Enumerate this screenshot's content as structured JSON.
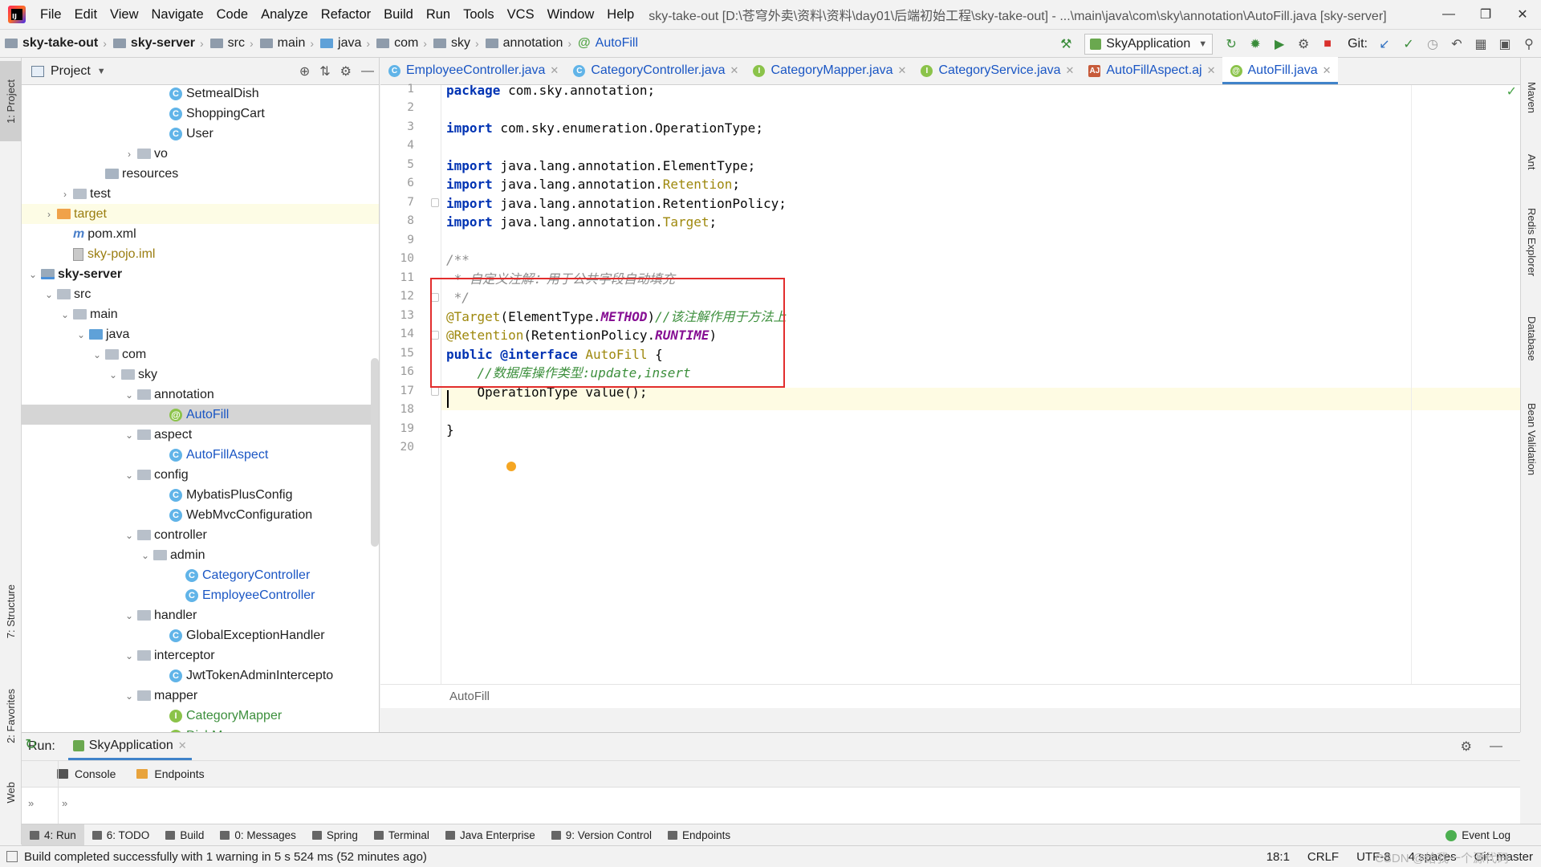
{
  "menu": {
    "items": [
      "File",
      "Edit",
      "View",
      "Navigate",
      "Code",
      "Analyze",
      "Refactor",
      "Build",
      "Run",
      "Tools",
      "VCS",
      "Window",
      "Help"
    ],
    "title": "sky-take-out [D:\\苍穹外卖\\资料\\资料\\day01\\后端初始工程\\sky-take-out] - ...\\main\\java\\com\\sky\\annotation\\AutoFill.java [sky-server]"
  },
  "breadcrumbs": [
    "sky-take-out",
    "sky-server",
    "src",
    "main",
    "java",
    "com",
    "sky",
    "annotation",
    "AutoFill"
  ],
  "toolbar": {
    "run_config": "SkyApplication",
    "git_label": "Git:"
  },
  "project": {
    "title": "Project",
    "tree": [
      {
        "label": "SetmealDish",
        "type": "class",
        "indent": 9
      },
      {
        "label": "ShoppingCart",
        "type": "class",
        "indent": 9
      },
      {
        "label": "User",
        "type": "class",
        "indent": 9
      },
      {
        "label": "vo",
        "type": "pkg",
        "indent": 7,
        "arrow": "›"
      },
      {
        "label": "resources",
        "type": "res",
        "indent": 5
      },
      {
        "label": "test",
        "type": "pkg",
        "indent": 3,
        "arrow": "›"
      },
      {
        "label": "target",
        "type": "orange",
        "indent": 2,
        "arrow": "›"
      },
      {
        "label": "pom.xml",
        "type": "maven",
        "indent": 3
      },
      {
        "label": "sky-pojo.iml",
        "type": "file",
        "indent": 3
      },
      {
        "label": "sky-server",
        "type": "mod",
        "indent": 1,
        "arrow": "⌄"
      },
      {
        "label": "src",
        "type": "pkg",
        "indent": 2,
        "arrow": "⌄"
      },
      {
        "label": "main",
        "type": "pkg",
        "indent": 3,
        "arrow": "⌄"
      },
      {
        "label": "java",
        "type": "src",
        "indent": 4,
        "arrow": "⌄"
      },
      {
        "label": "com",
        "type": "pkg",
        "indent": 5,
        "arrow": "⌄"
      },
      {
        "label": "sky",
        "type": "pkg",
        "indent": 6,
        "arrow": "⌄"
      },
      {
        "label": "annotation",
        "type": "pkg",
        "indent": 7,
        "arrow": "⌄"
      },
      {
        "label": "AutoFill",
        "type": "anno",
        "indent": 9
      },
      {
        "label": "aspect",
        "type": "pkg",
        "indent": 7,
        "arrow": "⌄"
      },
      {
        "label": "AutoFillAspect",
        "type": "class",
        "indent": 9
      },
      {
        "label": "config",
        "type": "pkg",
        "indent": 7,
        "arrow": "⌄"
      },
      {
        "label": "MybatisPlusConfig",
        "type": "class",
        "indent": 9
      },
      {
        "label": "WebMvcConfiguration",
        "type": "class",
        "indent": 9
      },
      {
        "label": "controller",
        "type": "pkg",
        "indent": 7,
        "arrow": "⌄"
      },
      {
        "label": "admin",
        "type": "pkg",
        "indent": 8,
        "arrow": "⌄"
      },
      {
        "label": "CategoryController",
        "type": "class",
        "indent": 10
      },
      {
        "label": "EmployeeController",
        "type": "class",
        "indent": 10
      },
      {
        "label": "handler",
        "type": "pkg",
        "indent": 7,
        "arrow": "⌄"
      },
      {
        "label": "GlobalExceptionHandler",
        "type": "class",
        "indent": 9
      },
      {
        "label": "interceptor",
        "type": "pkg",
        "indent": 7,
        "arrow": "⌄"
      },
      {
        "label": "JwtTokenAdminIntercepto",
        "type": "class",
        "indent": 9
      },
      {
        "label": "mapper",
        "type": "pkg",
        "indent": 7,
        "arrow": "⌄"
      },
      {
        "label": "CategoryMapper",
        "type": "iface",
        "indent": 9
      },
      {
        "label": "DishMapper",
        "type": "iface",
        "indent": 9
      }
    ]
  },
  "tabs": [
    {
      "label": "EmployeeController.java",
      "icon": "c"
    },
    {
      "label": "CategoryController.java",
      "icon": "c"
    },
    {
      "label": "CategoryMapper.java",
      "icon": "i"
    },
    {
      "label": "CategoryService.java",
      "icon": "i"
    },
    {
      "label": "AutoFillAspect.aj",
      "icon": "aj"
    },
    {
      "label": "AutoFill.java",
      "icon": "a",
      "active": true
    }
  ],
  "editor": {
    "line_numbers": [
      "1",
      "2",
      "3",
      "4",
      "5",
      "6",
      "7",
      "8",
      "9",
      "10",
      "11",
      "12",
      "13",
      "14",
      "15",
      "16",
      "17",
      "18",
      "19",
      "20"
    ],
    "code": {
      "l1_kw": "package",
      "l1_rest": " com.sky.annotation;",
      "l3_kw": "import",
      "l3_rest": " com.sky.enumeration.OperationType;",
      "l5_kw": "import",
      "l5_rest": " java.lang.annotation.ElementType;",
      "l6_kw": "import",
      "l6_a": " java.lang.annotation.",
      "l6_b": "Retention",
      "l6_c": ";",
      "l7_kw": "import",
      "l7_rest": " java.lang.annotation.RetentionPolicy;",
      "l8_kw": "import",
      "l8_a": " java.lang.annotation.",
      "l8_b": "Target",
      "l8_c": ";",
      "l10": "/**",
      "l11": " * 自定义注解：用于公共字段自动填充",
      "l12": " */",
      "l13_a": "@Target",
      "l13_b": "(ElementType.",
      "l13_c": "METHOD",
      "l13_d": ")",
      "l13_e": "//该注解作用于方法上",
      "l14_a": "@Retention",
      "l14_b": "(RetentionPolicy.",
      "l14_c": "RUNTIME",
      "l14_d": ")",
      "l15_kw": "public",
      "l15_kw2": " @interface",
      "l15_name": " AutoFill",
      "l15_rest": " {",
      "l16": "    //数据库操作类型:update,insert",
      "l17": "    OperationType value();",
      "l19": "}"
    },
    "breadcrumb": "AutoFill",
    "cursor_position_line": 18
  },
  "run_panel": {
    "label": "Run:",
    "tab": "SkyApplication",
    "sub_tabs": [
      "Console",
      "Endpoints"
    ]
  },
  "bottom_tabs": [
    {
      "label": "4: Run",
      "active": true
    },
    {
      "label": "6: TODO"
    },
    {
      "label": "Build"
    },
    {
      "label": "0: Messages"
    },
    {
      "label": "Spring"
    },
    {
      "label": "Terminal"
    },
    {
      "label": "Java Enterprise"
    },
    {
      "label": "9: Version Control"
    },
    {
      "label": "Endpoints"
    }
  ],
  "event_log": "Event Log",
  "left_stripe": [
    "1: Project",
    "7: Structure",
    "2: Favorites",
    "Web"
  ],
  "right_stripe": [
    "Maven",
    "Ant",
    "Redis Explorer",
    "Database",
    "Bean Validation"
  ],
  "status": {
    "message": "Build completed successfully with 1 warning in 5 s 524 ms (52 minutes ago)",
    "position": "18:1",
    "line_sep": "CRLF",
    "encoding": "UTF-8",
    "indent": "4 spaces",
    "git": "Git: master",
    "watermark": "CSDN @给我一个源代码"
  }
}
